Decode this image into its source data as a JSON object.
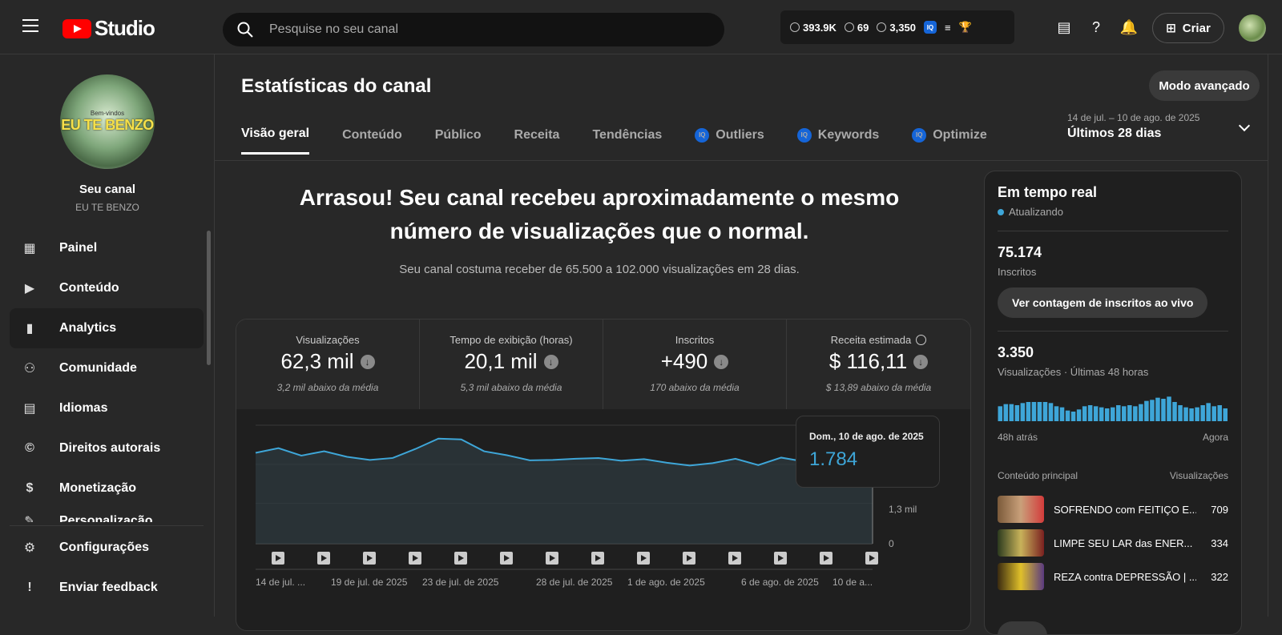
{
  "topbar": {
    "logo_text": "Studio",
    "search_placeholder": "Pesquise no seu canal",
    "stats": [
      "393.9K",
      "69",
      "3,350"
    ],
    "create_label": "Criar"
  },
  "sidebar": {
    "channel_label": "Seu canal",
    "channel_name": "EU TE BENZO",
    "avatar_small": "Bem-vindos",
    "avatar_title": "EU TE BENZO",
    "items": [
      {
        "label": "Painel",
        "icon": "dashboard-icon",
        "glyph": "▦"
      },
      {
        "label": "Conteúdo",
        "icon": "content-icon",
        "glyph": "▶"
      },
      {
        "label": "Analytics",
        "icon": "analytics-icon",
        "glyph": "▮"
      },
      {
        "label": "Comunidade",
        "icon": "community-icon",
        "glyph": "👥"
      },
      {
        "label": "Idiomas",
        "icon": "subtitles-icon",
        "glyph": "▤"
      },
      {
        "label": "Direitos autorais",
        "icon": "copyright-icon",
        "glyph": "©"
      },
      {
        "label": "Monetização",
        "icon": "dollar-icon",
        "glyph": "$"
      },
      {
        "label": "Personalização",
        "icon": "customization-icon",
        "glyph": "✎"
      }
    ],
    "bottom": [
      {
        "label": "Configurações",
        "icon": "settings-icon",
        "glyph": "⚙"
      },
      {
        "label": "Enviar feedback",
        "icon": "feedback-icon",
        "glyph": "!"
      }
    ]
  },
  "main": {
    "title": "Estatísticas do canal",
    "advanced_mode": "Modo avançado",
    "tabs": [
      "Visão geral",
      "Conteúdo",
      "Público",
      "Receita",
      "Tendências",
      "Outliers",
      "Keywords",
      "Optimize"
    ],
    "date_range": "14 de jul. – 10 de ago. de 2025",
    "period": "Últimos 28 dias",
    "headline_line1": "Arrasou! Seu canal recebeu aproximadamente o mesmo",
    "headline_line2": "número de visualizações que o normal.",
    "subline": "Seu canal costuma receber de 65.500 a 102.000 visualizações em 28 dias."
  },
  "metrics": [
    {
      "label": "Visualizações",
      "value": "62,3 mil",
      "note": "3,2 mil abaixo da média"
    },
    {
      "label": "Tempo de exibição (horas)",
      "value": "20,1 mil",
      "note": "5,3 mil abaixo da média"
    },
    {
      "label": "Inscritos",
      "value": "+490",
      "note": "170 abaixo da média"
    },
    {
      "label": "Receita estimada",
      "value": "$ 116,11",
      "note": "$ 13,89 abaixo da média"
    }
  ],
  "tooltip": {
    "date": "Dom., 10 de ago. de 2025",
    "value": "1.784"
  },
  "chart_data": {
    "type": "area",
    "x": [
      "14 de jul.",
      "15",
      "16",
      "17",
      "18",
      "19 de jul. de 2025",
      "20",
      "21",
      "22",
      "23 de jul. de 2025",
      "24",
      "25",
      "26",
      "27",
      "28 de jul. de 2025",
      "29",
      "30",
      "31",
      "1 de ago. de 2025",
      "2",
      "3",
      "4",
      "5",
      "6 de ago. de 2025",
      "7",
      "8",
      "9",
      "10 de ago. de 2025"
    ],
    "series": [
      {
        "values": [
          2300,
          2420,
          2230,
          2340,
          2200,
          2120,
          2170,
          2400,
          2660,
          2640,
          2340,
          2240,
          2110,
          2120,
          2150,
          2170,
          2100,
          2140,
          2050,
          1980,
          2040,
          2150,
          1990,
          2180,
          2080,
          2320,
          1750,
          1784
        ]
      }
    ],
    "x_tick_labels": [
      "14 de jul. ...",
      "19 de jul. de 2025",
      "23 de jul. de 2025",
      "28 de jul. de 2025",
      "1 de ago. de 2025",
      "6 de ago. de 2025",
      "10 de a..."
    ],
    "y_tick_labels": [
      "1,3 mil",
      "0"
    ],
    "ylim": [
      0,
      3000
    ],
    "grid": true
  },
  "realtime": {
    "title": "Em tempo real",
    "status": "Atualizando",
    "subscribers": "75.174",
    "subscribers_label": "Inscritos",
    "live_button": "Ver contagem de inscritos ao vivo",
    "views": "3.350",
    "views_label": "Visualizações · Últimas 48 horas",
    "axis_left": "48h atrás",
    "axis_right": "Agora",
    "bars": [
      14,
      16,
      16,
      15,
      17,
      18,
      18,
      18,
      18,
      17,
      14,
      13,
      10,
      9,
      11,
      14,
      15,
      14,
      13,
      12,
      13,
      15,
      14,
      15,
      14,
      16,
      19,
      20,
      22,
      21,
      23,
      18,
      15,
      13,
      12,
      13,
      15,
      17,
      14,
      15,
      12
    ],
    "top_header_left": "Conteúdo principal",
    "top_header_right": "Visualizações",
    "top_videos": [
      {
        "title": "SOFRENDO com FEITIÇO E...",
        "views": "709"
      },
      {
        "title": "LIMPE SEU LAR das ENER...",
        "views": "334"
      },
      {
        "title": "REZA contra DEPRESSÃO | ...",
        "views": "322"
      }
    ]
  },
  "colors": {
    "accent": "#3ea6d8",
    "brand": "#ff0000",
    "iq": "#1565d8"
  }
}
